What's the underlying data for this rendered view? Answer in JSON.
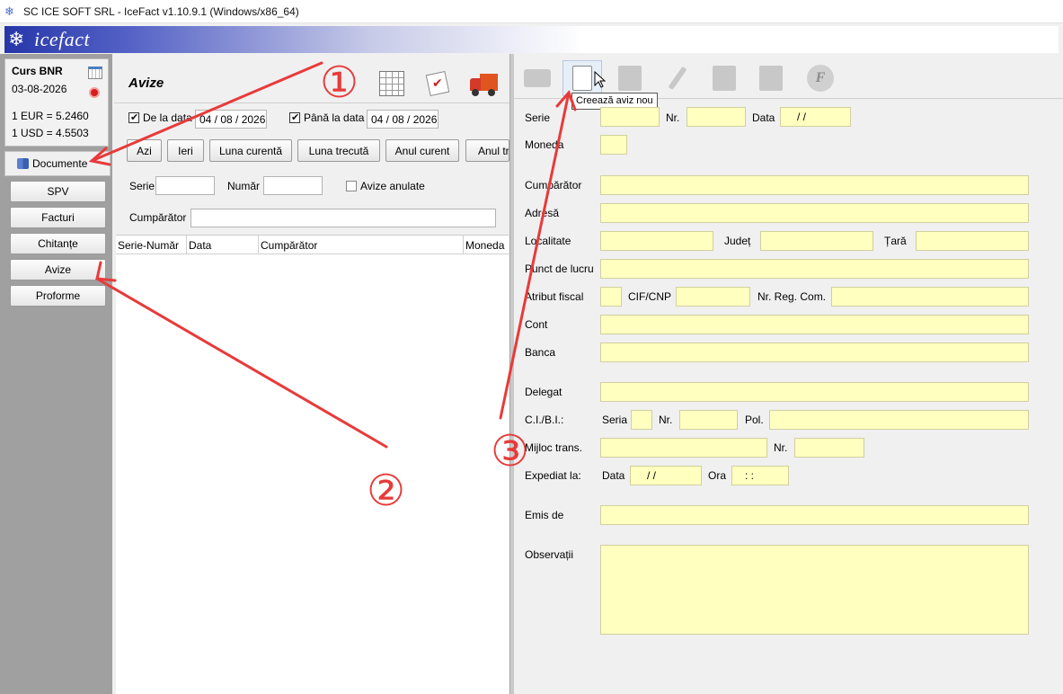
{
  "window": {
    "title": "SC ICE SOFT SRL - IceFact v1.10.9.1 (Windows/x86_64)"
  },
  "banner": {
    "logo_text": "icefact"
  },
  "bnr": {
    "title": "Curs BNR",
    "date": "03-08-2026",
    "rates": [
      "1 EUR = 5.2460",
      "1 USD = 4.5503"
    ]
  },
  "sidebar": {
    "section_label": "Documente",
    "items": [
      {
        "label": "SPV"
      },
      {
        "label": "Facturi"
      },
      {
        "label": "Chitanțe"
      },
      {
        "label": "Avize"
      },
      {
        "label": "Proforme"
      }
    ]
  },
  "filter": {
    "title": "Avize",
    "from_label": "De la data",
    "from_value": "04 / 08 / 2026",
    "to_label": "Până la data",
    "to_value": "04 / 08 / 2026",
    "period_buttons": [
      "Azi",
      "Ieri",
      "Luna curentă",
      "Luna trecută",
      "Anul curent",
      "Anul trecut"
    ],
    "serie_label": "Serie",
    "numar_label": "Număr",
    "anulate_label": "Avize anulate",
    "cumparator_label": "Cumpărător",
    "columns": [
      "Serie-Număr",
      "Data",
      "Cumpărător",
      "Moneda"
    ]
  },
  "form": {
    "tooltip": "Creează aviz nou",
    "toolbar_icons": [
      "print-icon",
      "new-document-icon",
      "copy-document-icon",
      "edit-icon",
      "delete-icon",
      "cut-icon",
      "efactura-icon"
    ],
    "efactura_letter": "F",
    "serie": "Serie",
    "nr": "Nr.",
    "data": "Data",
    "date_placeholder": "/     /",
    "moneda": "Moneda",
    "cumparator": "Cumpărător",
    "adresa": "Adresă",
    "localitate": "Localitate",
    "judet": "Județ",
    "tara": "Țară",
    "punct_lucru": "Punct de lucru",
    "atribut_fiscal": "Atribut fiscal",
    "cif": "CIF/CNP",
    "reg_com": "Nr. Reg. Com.",
    "cont": "Cont",
    "banca": "Banca",
    "delegat": "Delegat",
    "ci_bi": "C.I./B.I.:",
    "seria": "Seria",
    "nr2": "Nr.",
    "pol": "Pol.",
    "mijloc": "Mijloc trans.",
    "nr3": "Nr.",
    "expediat": "Expediat la:",
    "exp_data": "Data",
    "ora": "Ora",
    "time_placeholder": ":     :",
    "emis_de": "Emis de",
    "observatii": "Observații"
  },
  "annotations": [
    {
      "label": "①"
    },
    {
      "label": "②"
    },
    {
      "label": "③"
    }
  ],
  "colors": {
    "field_bg": "#ffffc0",
    "arrow": "#e83a3a",
    "banner_dark": "#2636a8"
  }
}
